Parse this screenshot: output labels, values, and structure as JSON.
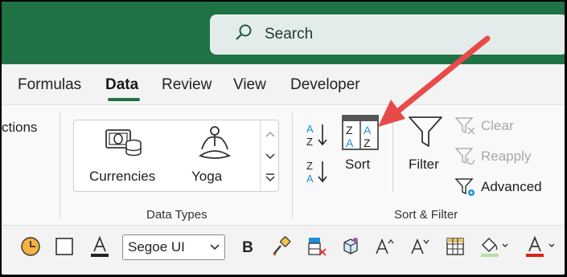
{
  "search": {
    "placeholder": "Search"
  },
  "tabs": [
    {
      "label": "Formulas"
    },
    {
      "label": "Data"
    },
    {
      "label": "Review"
    },
    {
      "label": "View"
    },
    {
      "label": "Developer"
    }
  ],
  "ribbon": {
    "left_cut_label": "ctions",
    "data_types": {
      "items": [
        {
          "label": "Currencies",
          "icon": "currencies-icon"
        },
        {
          "label": "Yoga",
          "icon": "yoga-icon"
        }
      ],
      "group_label": "Data Types"
    },
    "sort_filter": {
      "sort_label": "Sort",
      "filter_label": "Filter",
      "clear_label": "Clear",
      "reapply_label": "Reapply",
      "advanced_label": "Advanced",
      "group_label": "Sort & Filter"
    }
  },
  "qat": {
    "font_value": "Segoe UI",
    "bold_label": "B"
  },
  "colors": {
    "title_green": "#1f7244",
    "arrow_red": "#e84a4a",
    "sort_blue": "#1e8fd6"
  }
}
